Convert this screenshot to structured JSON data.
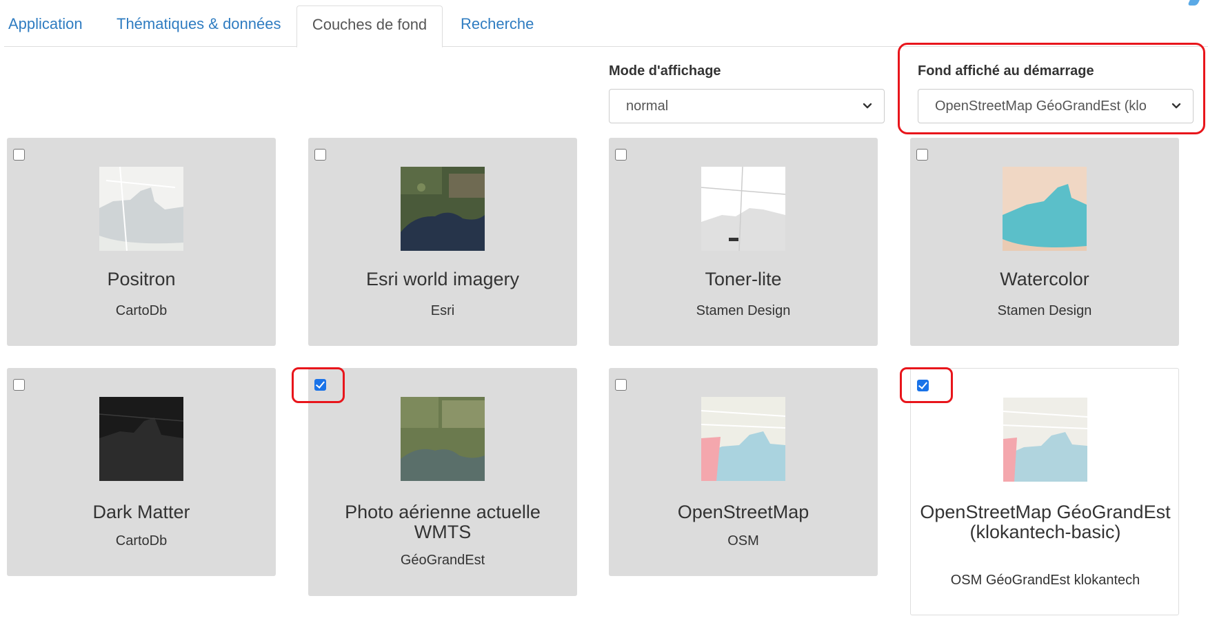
{
  "tabs": [
    {
      "label": "Application",
      "active": false
    },
    {
      "label": "Thématiques & données",
      "active": false
    },
    {
      "label": "Couches de fond",
      "active": true
    },
    {
      "label": "Recherche",
      "active": false
    }
  ],
  "display_mode": {
    "label": "Mode d'affichage",
    "value": "normal"
  },
  "startup_background": {
    "label": "Fond affiché au démarrage",
    "value": "OpenStreetMap GéoGrandEst (klo"
  },
  "colors": {
    "link": "#2f7cc1",
    "highlight": "#e8151b",
    "card_bg": "#dcdcdc",
    "checkbox_checked": "#1a73e8"
  },
  "cards": [
    {
      "title": "Positron",
      "subtitle": "CartoDb",
      "checked": false,
      "thumbnail": "positron-map-thumbnail"
    },
    {
      "title": "Esri world imagery",
      "subtitle": "Esri",
      "checked": false,
      "thumbnail": "satellite-map-thumbnail"
    },
    {
      "title": "Toner-lite",
      "subtitle": "Stamen Design",
      "checked": false,
      "thumbnail": "toner-map-thumbnail"
    },
    {
      "title": "Watercolor",
      "subtitle": "Stamen Design",
      "checked": false,
      "thumbnail": "watercolor-map-thumbnail"
    },
    {
      "title": "Dark Matter",
      "subtitle": "CartoDb",
      "checked": false,
      "thumbnail": "dark-map-thumbnail"
    },
    {
      "title": "Photo aérienne actuelle WMTS",
      "subtitle": "GéoGrandEst",
      "checked": true,
      "thumbnail": "aerial-photo-thumbnail"
    },
    {
      "title": "OpenStreetMap",
      "subtitle": "OSM",
      "checked": false,
      "thumbnail": "osm-map-thumbnail"
    },
    {
      "title": "OpenStreetMap GéoGrandEst (klokantech-basic)",
      "subtitle": "OSM GéoGrandEst klokantech",
      "checked": true,
      "thumbnail": "osm-klokantech-thumbnail"
    }
  ]
}
